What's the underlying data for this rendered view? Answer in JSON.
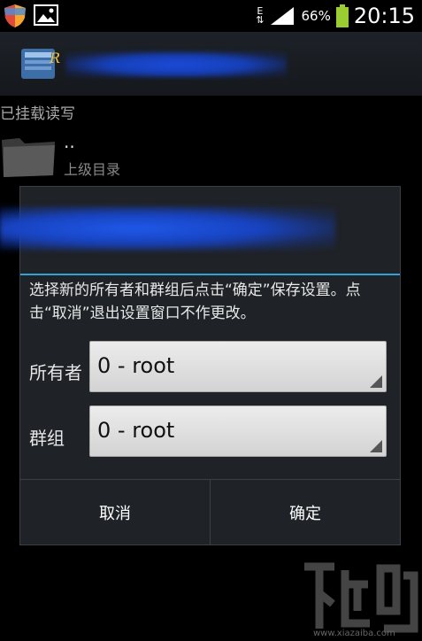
{
  "status_bar": {
    "network_label": "E",
    "battery_percent": "66%",
    "time": "20:15",
    "icons": [
      "shield-icon",
      "image-icon",
      "signal-icon",
      "battery-icon"
    ]
  },
  "list": {
    "section_label": "已挂载读写",
    "parent_row": {
      "name": "..",
      "subtitle": "上级目录"
    }
  },
  "dialog": {
    "message": "选择新的所有者和群组后点击“确定”保存设置。点击“取消”退出设置窗口不作更改。",
    "owner": {
      "label": "所有者",
      "value": "0 - root"
    },
    "group": {
      "label": "群组",
      "value": "0 - root"
    },
    "cancel_label": "取消",
    "ok_label": "确定"
  },
  "watermark": {
    "text": "www.xiazaiba.com"
  },
  "colors": {
    "accent": "#2da3d6",
    "dialog_bg": "#1f2226",
    "battery": "#9acd32"
  }
}
